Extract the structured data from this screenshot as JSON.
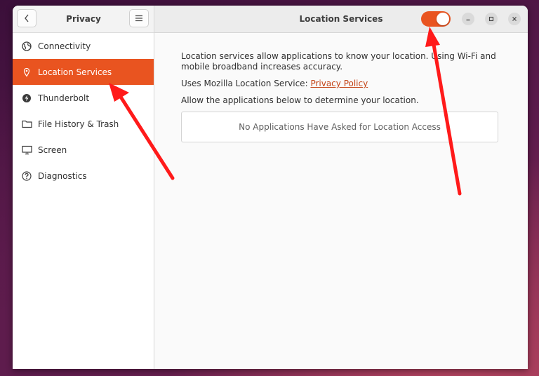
{
  "sidebar_header": {
    "title": "Privacy",
    "back_icon": "chevron-left-icon",
    "menu_icon": "hamburger-menu-icon"
  },
  "main_header": {
    "title": "Location Services",
    "toggle_on": true
  },
  "window_controls": [
    "minimize-icon",
    "maximize-icon",
    "close-icon"
  ],
  "sidebar": {
    "items": [
      {
        "label": "Connectivity",
        "icon": "globe-icon"
      },
      {
        "label": "Location Services",
        "icon": "location-pin-icon",
        "active": true
      },
      {
        "label": "Thunderbolt",
        "icon": "thunderbolt-icon"
      },
      {
        "label": "File History & Trash",
        "icon": "folder-icon"
      },
      {
        "label": "Screen",
        "icon": "monitor-icon"
      },
      {
        "label": "Diagnostics",
        "icon": "question-icon"
      }
    ]
  },
  "content": {
    "description": "Location services allow applications to know your location. Using Wi-Fi and mobile broadband increases accuracy.",
    "service_prefix": "Uses Mozilla Location Service: ",
    "service_link": "Privacy Policy",
    "allow_text": "Allow the applications below to determine your location.",
    "empty_message": "No Applications Have Asked for Location Access"
  },
  "colors": {
    "accent": "#e95420",
    "annotation_arrow": "#ff1a1a",
    "link": "#c34113"
  }
}
